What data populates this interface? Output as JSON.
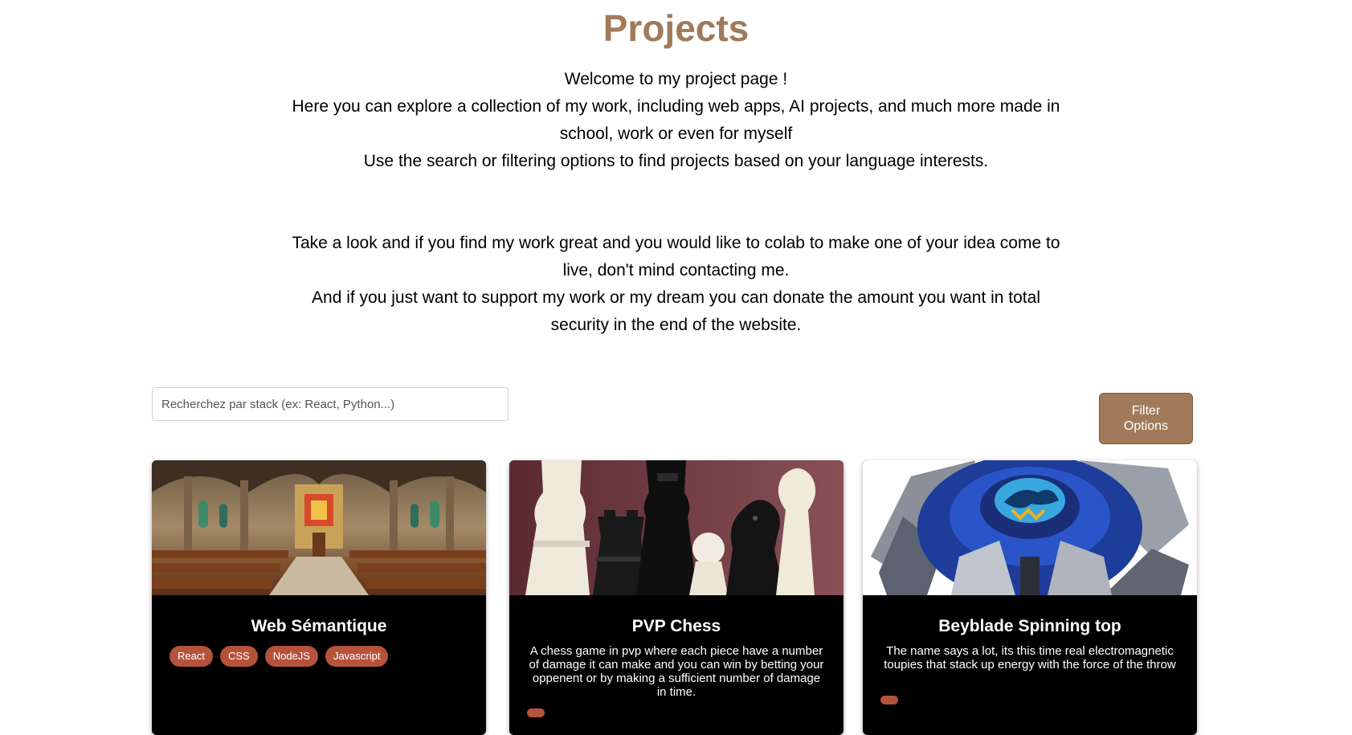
{
  "page": {
    "title": "Projects",
    "intro_lines": [
      "Welcome to my project page !",
      "Here you can explore a collection of my work, including web apps, AI projects, and much more made in school, work or even for myself",
      "Use the search or filtering options to find projects based on your language interests."
    ],
    "outro_lines": [
      "Take a look and if you find my work great and you would like to colab to make one of your idea come to live, don't mind contacting me.",
      "And if you just want to support my work or my dream you can donate the amount you want in total security in the end of the website."
    ]
  },
  "search": {
    "placeholder": "Recherchez par stack (ex: React, Python...)",
    "value": ""
  },
  "filter": {
    "label": "Filter Options"
  },
  "projects": [
    {
      "title": "Web Sémantique",
      "image": "church-interior-image",
      "description": "",
      "tags": [
        "React",
        "CSS",
        "NodeJS",
        "Javascript"
      ]
    },
    {
      "title": "PVP Chess",
      "image": "chess-pieces-image",
      "description": "A chess game in pvp where each piece have a number of damage it can make and you can win by betting your oppenent or by making a sufficient number of damage in time.",
      "tags": []
    },
    {
      "title": "Beyblade Spinning top",
      "image": "beyblade-image",
      "description": "The name says a lot, its this time real electromagnetic toupies that stack up energy with the force of the throw",
      "tags": []
    }
  ],
  "colors": {
    "accent": "#a07a5a",
    "tag": "#b5533a",
    "card_bg": "#000000"
  }
}
